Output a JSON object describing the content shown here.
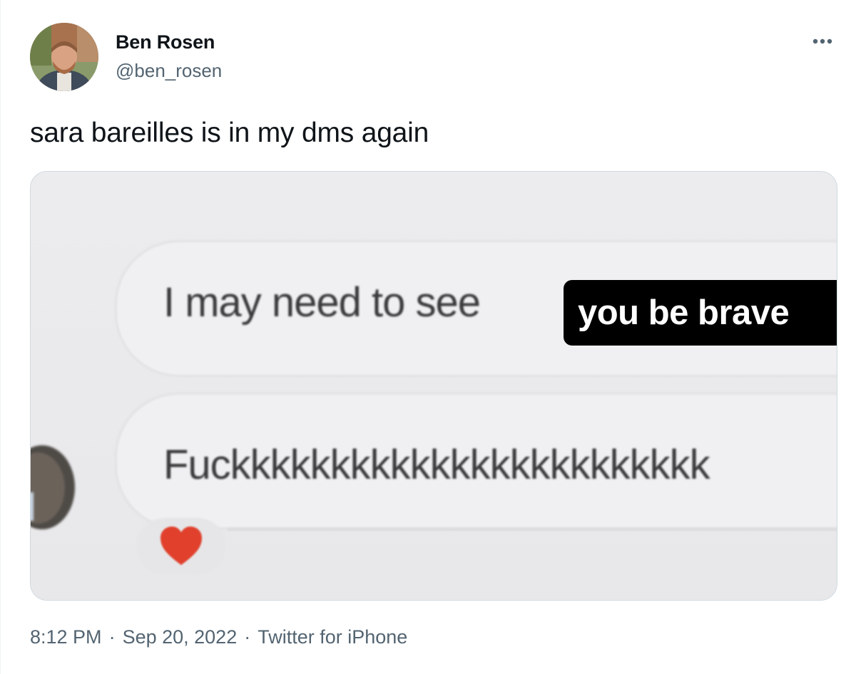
{
  "author": {
    "name": "Ben Rosen",
    "handle": "@ben_rosen",
    "avatar_icon": "profile-photo"
  },
  "more_icon": "more-horizontal-icon",
  "tweet": {
    "text": "sara bareilles is in my dms again"
  },
  "media": {
    "message_1": "I may need to see",
    "caption": "you be brave",
    "message_2": "Fuckkkkkkkkkkkkkkkkkkkkkkkk",
    "reaction_icon": "heart-icon",
    "reaction_color": "#e0402c"
  },
  "meta": {
    "time": "8:12 PM",
    "separator": "·",
    "date": "Sep 20, 2022",
    "source": "Twitter for iPhone"
  },
  "colors": {
    "text_primary": "#0f1419",
    "text_secondary": "#536471",
    "border": "#cfd9de"
  }
}
